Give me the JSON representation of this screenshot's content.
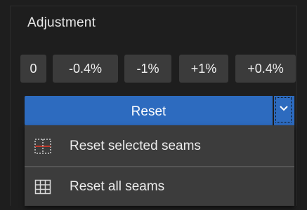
{
  "panel": {
    "title": "Adjustment"
  },
  "steps": [
    {
      "label": "0"
    },
    {
      "label": "-0.4%"
    },
    {
      "label": "-1%"
    },
    {
      "label": "+1%"
    },
    {
      "label": "+0.4%"
    }
  ],
  "reset": {
    "label": "Reset",
    "dropdown_icon": "chevron-down-icon"
  },
  "menu": {
    "items": [
      {
        "label": "Reset selected seams",
        "icon": "selected-seams-icon"
      },
      {
        "label": "Reset all seams",
        "icon": "all-seams-grid-icon"
      }
    ]
  },
  "colors": {
    "background": "#1e1e1e",
    "button": "#3b3b3b",
    "accent": "#2d6bbf",
    "menu": "#3c3c3c",
    "seam_red": "#c0392b"
  }
}
